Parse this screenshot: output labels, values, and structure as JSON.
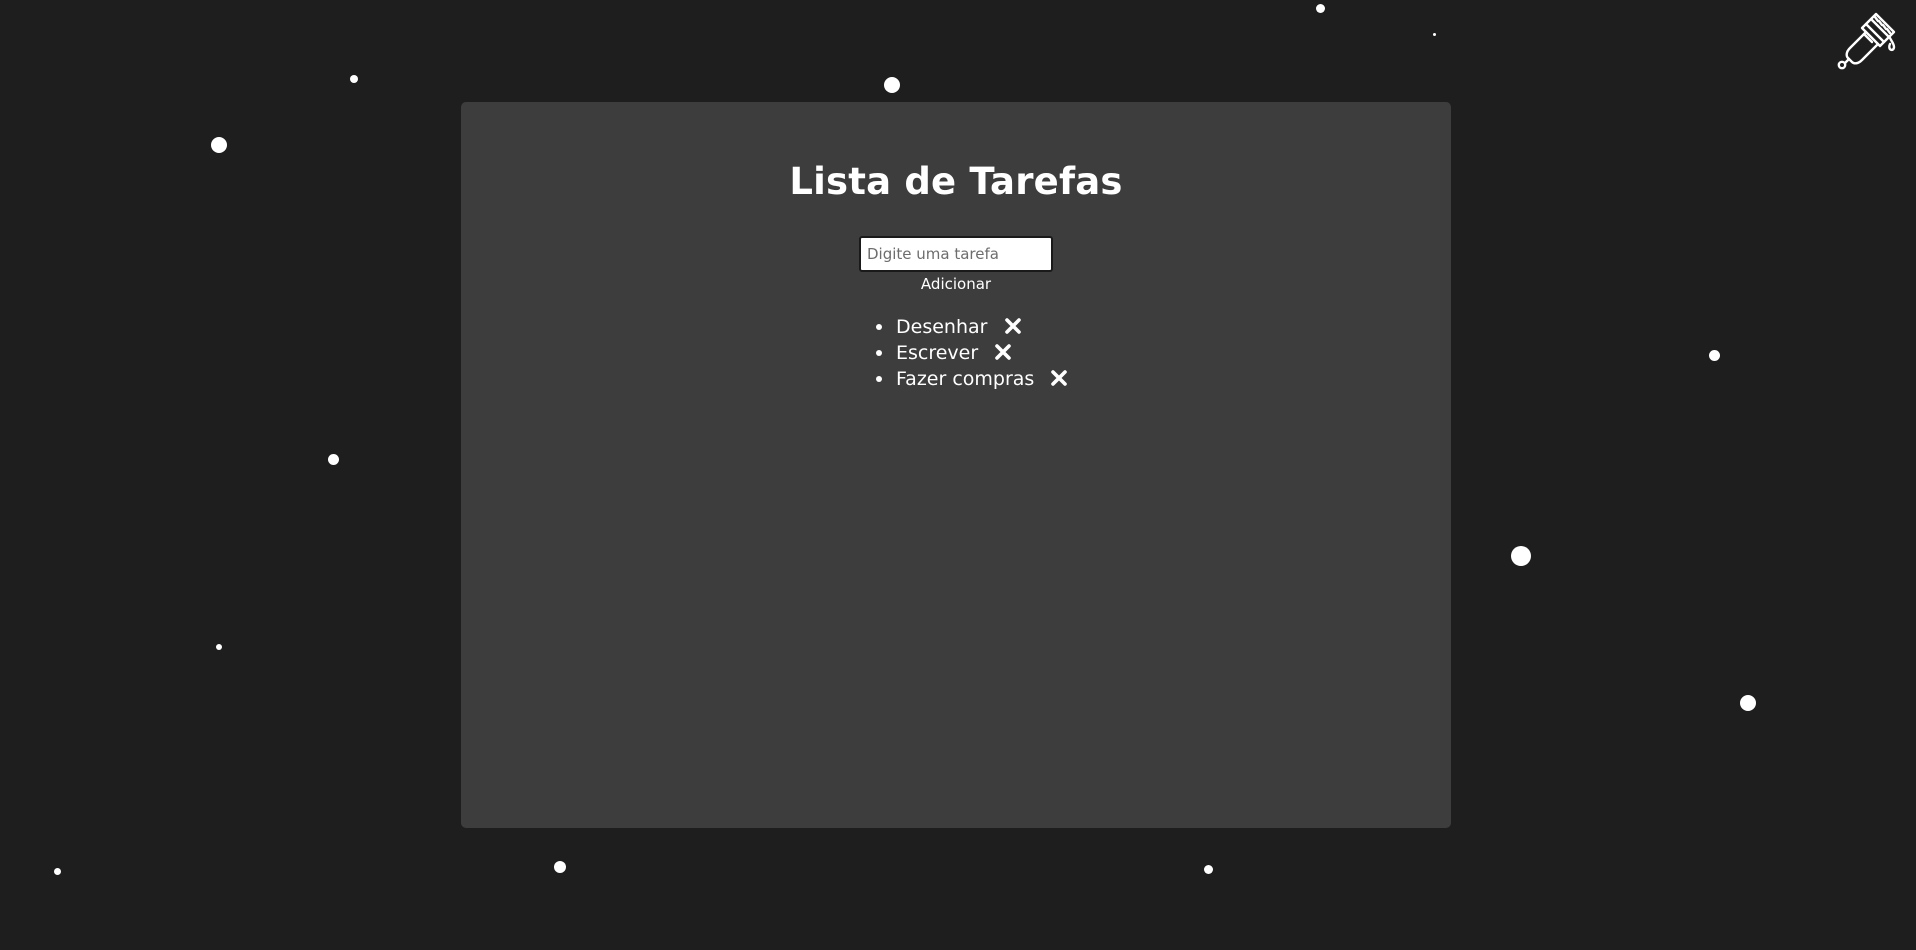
{
  "app": {
    "title": "Lista de Tarefas"
  },
  "form": {
    "input_value": "",
    "placeholder": "Digite uma tarefa",
    "add_label": "Adicionar"
  },
  "tasks": [
    {
      "label": "Desenhar"
    },
    {
      "label": "Escrever"
    },
    {
      "label": "Fazer compras"
    }
  ],
  "icons": {
    "theme_toggle": "paint-brush-icon",
    "remove": "close-icon",
    "background": "star-icon"
  },
  "colors": {
    "background": "#1e1e1e",
    "panel": "#3d3d3d",
    "text": "#ffffff"
  }
}
